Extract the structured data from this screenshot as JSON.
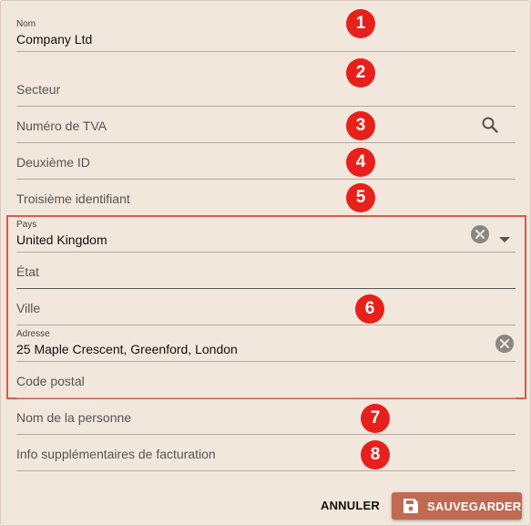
{
  "form": {
    "nom": {
      "label": "Nom",
      "value": "Company Ltd"
    },
    "secteur": {
      "placeholder": "Secteur"
    },
    "tva": {
      "placeholder": "Numéro de TVA"
    },
    "deuxieme_id": {
      "placeholder": "Deuxième ID"
    },
    "troisieme_id": {
      "placeholder": "Troisième identifiant"
    },
    "pays": {
      "label": "Pays",
      "value": "United Kingdom"
    },
    "etat": {
      "placeholder": "État"
    },
    "ville": {
      "placeholder": "Ville"
    },
    "adresse": {
      "label": "Adresse",
      "value": "25 Maple Crescent, Greenford, London"
    },
    "code_postal": {
      "placeholder": "Code postal"
    },
    "personne": {
      "placeholder": "Nom de la personne"
    },
    "info_facturation": {
      "placeholder": "Info supplémentaires de facturation"
    }
  },
  "badges": [
    "1",
    "2",
    "3",
    "4",
    "5",
    "6",
    "7",
    "8"
  ],
  "actions": {
    "cancel_label": "ANNULER",
    "save_label": "SAUVEGARDER"
  },
  "icons": {
    "search": "search-icon",
    "clear": "close-circle-icon",
    "dropdown": "caret-down-icon",
    "save": "floppy-disk-icon"
  },
  "colors": {
    "background": "#f2e7dc",
    "badge": "#e8201c",
    "highlight_border": "#e0574f",
    "save_button": "#c06a52"
  }
}
